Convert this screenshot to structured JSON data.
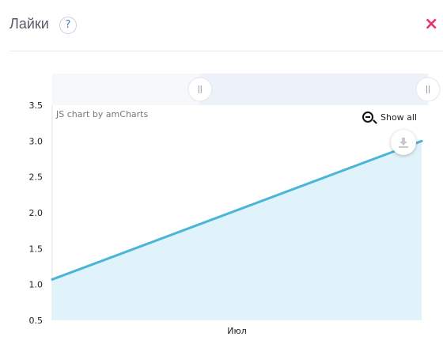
{
  "header": {
    "title": "Лайки",
    "help_label": "?",
    "close_label": "×"
  },
  "chart_data": {
    "type": "area",
    "title": "",
    "xlabel": "",
    "ylabel": "",
    "categories": [
      "Июл"
    ],
    "x_range_fraction": [
      0,
      1
    ],
    "series": [
      {
        "values_at_start_end": [
          1.07,
          3.0
        ]
      }
    ],
    "ylim": [
      0.5,
      3.5
    ],
    "yticks": [
      0.5,
      1.0,
      1.5,
      2.0,
      2.5,
      3.0,
      3.5
    ],
    "ytick_labels": [
      "0.5",
      "1.0",
      "1.5",
      "2.0",
      "2.5",
      "3.0",
      "3.5"
    ],
    "grid": false,
    "line_color": "#4bb4d9",
    "fill_color": "#e0f2fa",
    "scrollbar": {
      "selected_start": 0.4,
      "selected_end": 1.0
    }
  },
  "chart_ui": {
    "watermark": "JS chart by amCharts",
    "zoom_reset_label": "Show all",
    "zoom_icon": "zoom-out-icon",
    "export_icon": "download-icon"
  },
  "colors": {
    "accent_close": "#e8336b",
    "help_icon": "#4a78c2",
    "title_text": "#555b66"
  }
}
